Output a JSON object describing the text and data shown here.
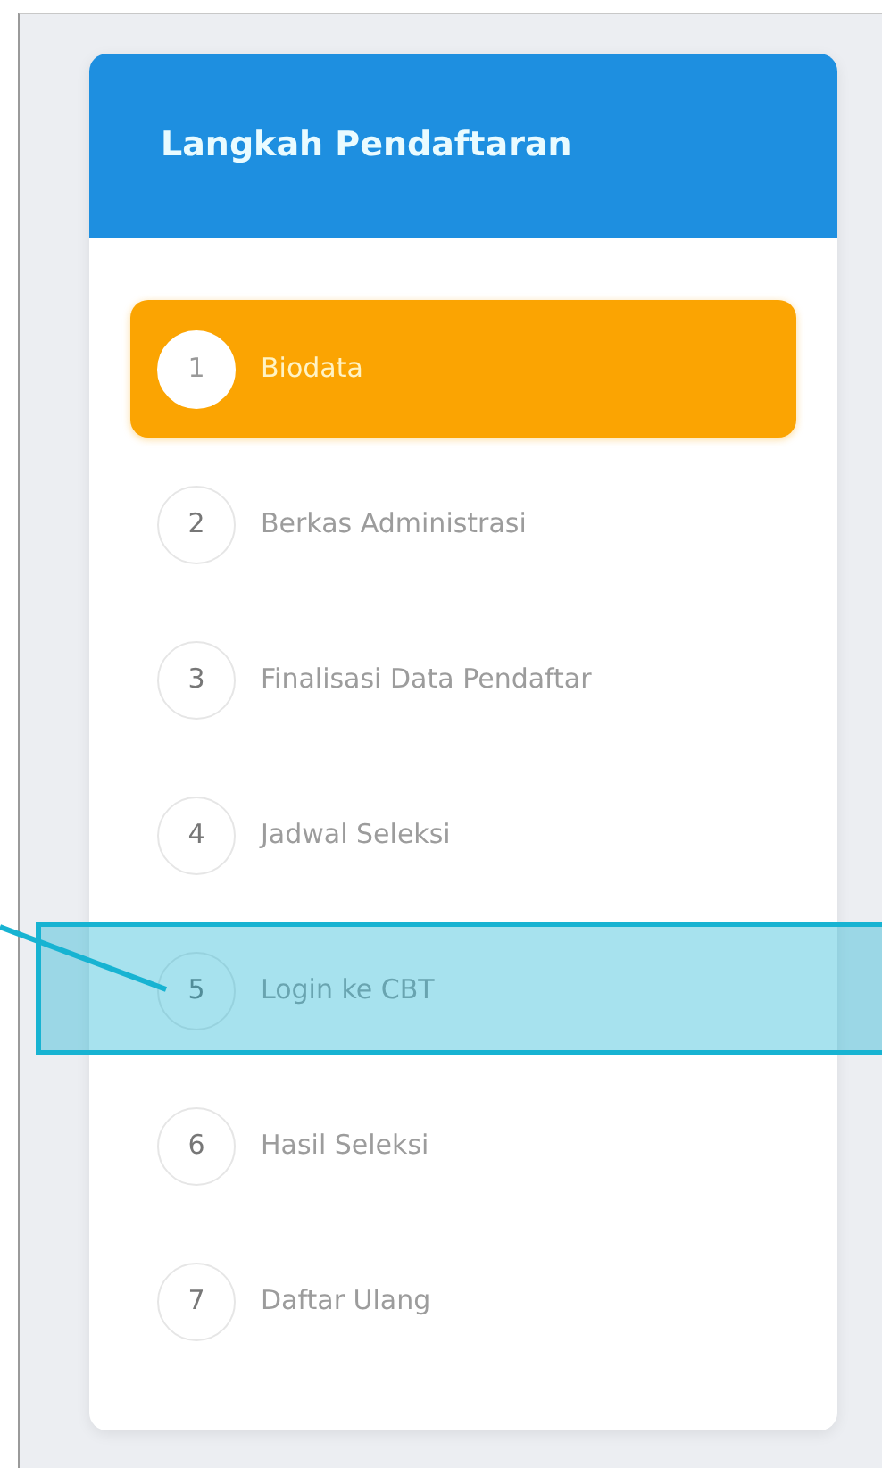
{
  "panel": {
    "title": "Langkah Pendaftaran"
  },
  "steps": [
    {
      "number": "1",
      "label": "Biodata",
      "selected": true,
      "highlighted": false
    },
    {
      "number": "2",
      "label": "Berkas Administrasi",
      "selected": false,
      "highlighted": false
    },
    {
      "number": "3",
      "label": "Finalisasi Data Pendaftar",
      "selected": false,
      "highlighted": false
    },
    {
      "number": "4",
      "label": "Jadwal Seleksi",
      "selected": false,
      "highlighted": false
    },
    {
      "number": "5",
      "label": "Login ke CBT",
      "selected": false,
      "highlighted": true
    },
    {
      "number": "6",
      "label": "Hasil Seleksi",
      "selected": false,
      "highlighted": false
    },
    {
      "number": "7",
      "label": "Daftar Ulang",
      "selected": false,
      "highlighted": false
    }
  ]
}
